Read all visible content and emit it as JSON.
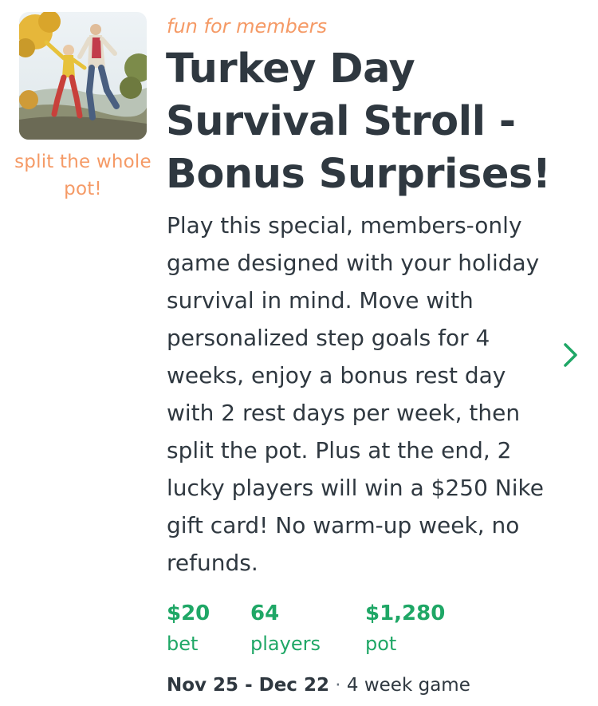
{
  "game": {
    "eyebrow": "fun for members",
    "title": "Turkey Day Survival Stroll - Bonus Surprises!",
    "description": "Play this special, members-only game designed with your holiday survival in mind. Move with personalized step goals for 4 weeks, enjoy a bonus rest day with 2 rest days per week, then split the pot. Plus at the end, 2 lucky players will win a $250 Nike gift card! No warm-up week, no refunds.",
    "thumbnail_caption": "split the whole pot!",
    "thumbnail_icon": "couple-walking-photo",
    "chevron_icon": "chevron-right-icon",
    "stats": {
      "bet": {
        "value": "$20",
        "label": "bet"
      },
      "players": {
        "value": "64",
        "label": "players"
      },
      "pot": {
        "value": "$1,280",
        "label": "pot"
      }
    },
    "date_range": "Nov 25 - Dec 22",
    "separator": "·",
    "duration": "4 week game"
  },
  "colors": {
    "accent_orange": "#f59a66",
    "accent_green": "#1fa766",
    "text_dark": "#2f3840"
  }
}
